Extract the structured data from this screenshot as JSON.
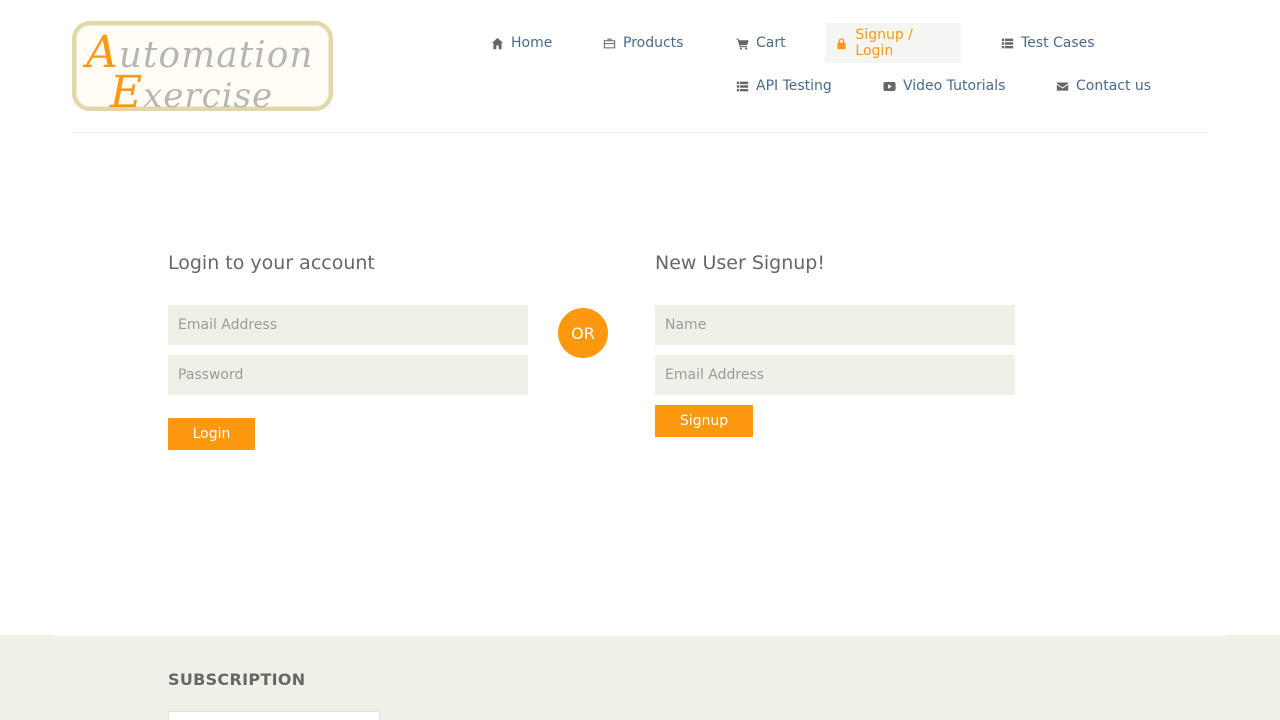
{
  "logo": {
    "line1_cap": "A",
    "line1_rest": "utomation",
    "line2_cap": "E",
    "line2_rest": "xercise"
  },
  "nav": {
    "home": "Home",
    "products": "Products",
    "cart": "Cart",
    "signup_login": "Signup / Login",
    "test_cases": "Test Cases",
    "api_testing": "API Testing",
    "video_tutorials": "Video Tutorials",
    "contact_us": "Contact us",
    "active_item": "Signup / Login"
  },
  "login": {
    "title": "Login to your account",
    "email_placeholder": "Email Address",
    "email_value": "",
    "password_placeholder": "Password",
    "password_value": "",
    "button": "Login"
  },
  "divider": {
    "label": "OR"
  },
  "signup": {
    "title": "New User Signup!",
    "name_placeholder": "Name",
    "name_value": "",
    "email_placeholder": "Email Address",
    "email_value": "",
    "button": "Signup"
  },
  "footer": {
    "subscription_title": "SUBSCRIPTION"
  },
  "colors": {
    "accent": "#fe980f",
    "text": "#696763",
    "link": "#4b6a8a",
    "input_bg": "#f0f0e9"
  }
}
